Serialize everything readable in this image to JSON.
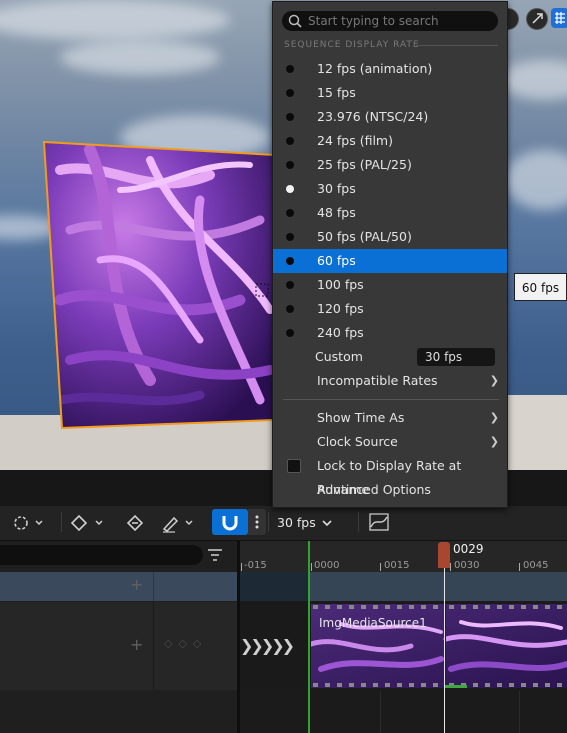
{
  "search": {
    "placeholder": "Start typing to search"
  },
  "menu": {
    "section_header": "SEQUENCE DISPLAY RATE",
    "rates": [
      {
        "label": "12 fps (animation)",
        "checked": false,
        "selected": false
      },
      {
        "label": "15 fps",
        "checked": false,
        "selected": false
      },
      {
        "label": "23.976 (NTSC/24)",
        "checked": false,
        "selected": false
      },
      {
        "label": "24 fps (film)",
        "checked": false,
        "selected": false
      },
      {
        "label": "25 fps (PAL/25)",
        "checked": false,
        "selected": false
      },
      {
        "label": "30 fps",
        "checked": true,
        "selected": false
      },
      {
        "label": "48 fps",
        "checked": false,
        "selected": false
      },
      {
        "label": "50 fps (PAL/50)",
        "checked": false,
        "selected": false
      },
      {
        "label": "60 fps",
        "checked": false,
        "selected": true
      },
      {
        "label": "100 fps",
        "checked": false,
        "selected": false
      },
      {
        "label": "120 fps",
        "checked": false,
        "selected": false
      },
      {
        "label": "240 fps",
        "checked": false,
        "selected": false
      }
    ],
    "custom": {
      "label": "Custom",
      "value": "30 fps"
    },
    "incompatible_rates": "Incompatible Rates",
    "show_time_as": "Show Time As",
    "clock_source": "Clock Source",
    "lock_display_rate": {
      "label": "Lock to Display Rate at Runtime",
      "checked": false
    },
    "advanced_options": "Advanced Options"
  },
  "tooltip": {
    "text": "60 fps"
  },
  "toolbar": {
    "fps_value": "30 fps"
  },
  "timeline": {
    "current_frame": "0029",
    "ticks": [
      "-015",
      "0000",
      "0015",
      "0030",
      "0045"
    ],
    "media_track_label": "ImgMediaSource1"
  },
  "colors": {
    "selection_blue": "#0b70d6",
    "menu_background": "#383838",
    "playhead": "#a8472f",
    "play_range_green": "#2fa52f",
    "media_section": "#3a2d4a"
  },
  "icons": [
    "search-icon",
    "transform-icon",
    "key-diamond-icon",
    "key-icon",
    "pen-icon",
    "snap-magnet-icon",
    "more-icon",
    "curve-editor-icon",
    "filter-icon",
    "chevron-down-icon",
    "chevron-right-icon",
    "plus-icon"
  ]
}
